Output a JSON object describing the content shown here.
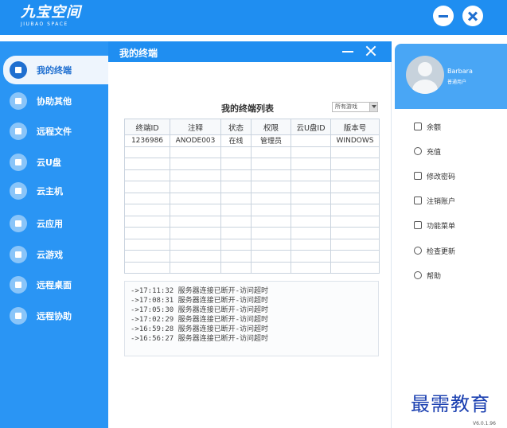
{
  "app": {
    "logo_main": "九宝空间",
    "logo_sub": "JIUBAO SPACE"
  },
  "sidebar": {
    "items": [
      {
        "label": "我的终端",
        "active": true
      },
      {
        "label": "协助其他"
      },
      {
        "label": "远程文件"
      },
      {
        "label": "云U盘"
      },
      {
        "label": "云主机"
      },
      {
        "label": "云应用"
      },
      {
        "label": "云游戏"
      },
      {
        "label": "远程桌面"
      },
      {
        "label": "远程协助"
      }
    ]
  },
  "panel": {
    "title": "我的终端",
    "list_title": "我的终端列表",
    "filter_value": "所有游戏",
    "columns": [
      "终端ID",
      "注释",
      "状态",
      "权限",
      "云U盘ID",
      "版本号"
    ],
    "rows": [
      [
        "1236986",
        "ANODE003",
        "在线",
        "管理员",
        "",
        "WINDOWS"
      ]
    ],
    "log": [
      "->17:11:32 服务器连接已断开-访问超时",
      "->17:08:31 服务器连接已断开-访问超时",
      "->17:05:30 服务器连接已断开-访问超时",
      "->17:02:29 服务器连接已断开-访问超时",
      "->16:59:28 服务器连接已断开-访问超时",
      "->16:56:27 服务器连接已断开-访问超时"
    ]
  },
  "user": {
    "name": "Barbara",
    "type": "普通用户"
  },
  "menu": {
    "items": [
      {
        "label": "余额",
        "icon": "wallet-icon"
      },
      {
        "label": "充值",
        "icon": "yuan-icon"
      },
      {
        "label": "修改密码",
        "icon": "lock-icon"
      },
      {
        "label": "注销账户",
        "icon": "logout-icon"
      },
      {
        "label": "功能菜单",
        "icon": "grid-icon"
      },
      {
        "label": "检查更新",
        "icon": "update-icon"
      },
      {
        "label": "帮助",
        "icon": "help-icon"
      }
    ]
  },
  "version": "V6.0.1.96",
  "watermark": "最需教育",
  "colors": {
    "primary": "#1f8ef1",
    "sidebar": "#2a95f4",
    "profile": "#49a6f5"
  }
}
